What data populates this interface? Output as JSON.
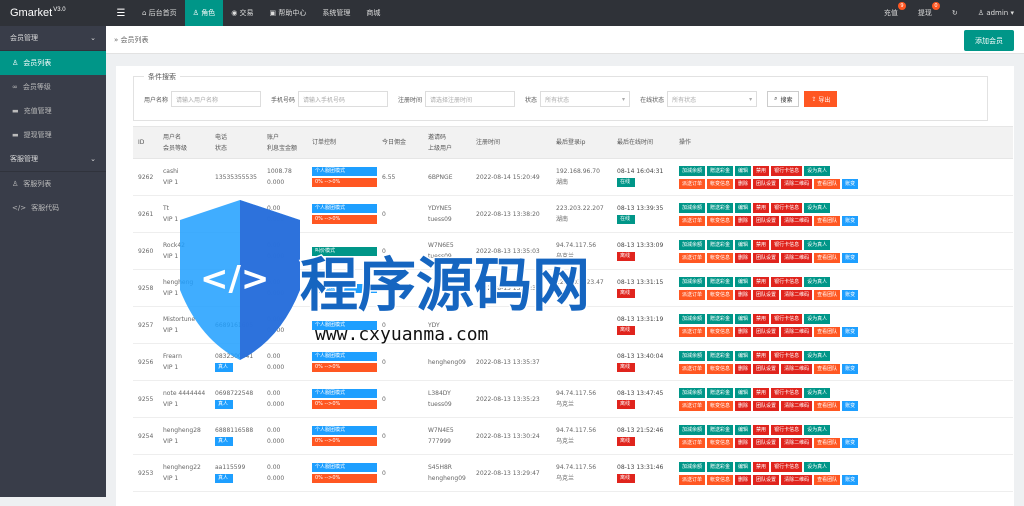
{
  "brand": {
    "name": "Gmarket",
    "version": "V3.0"
  },
  "topnav": [
    {
      "label": "后台首页",
      "icon": "home-icon"
    },
    {
      "label": "角色",
      "icon": "user-icon",
      "active": true
    },
    {
      "label": "交易",
      "icon": "trade-icon"
    },
    {
      "label": "帮助中心",
      "icon": "help-icon"
    },
    {
      "label": "系统管理",
      "icon": "settings-icon"
    },
    {
      "label": "商城",
      "icon": "shop-icon"
    }
  ],
  "topright": {
    "recharge": "充值",
    "recharge_badge": "9",
    "withdraw": "提现",
    "withdraw_badge": "0",
    "refresh_icon": "refresh-icon",
    "user": "admin"
  },
  "sidebar": {
    "group1": "会员管理",
    "items1": [
      "会员列表",
      "会员等级",
      "充值管理",
      "提现管理"
    ],
    "group2": "客服管理",
    "items2": [
      "客服列表",
      "客服代码"
    ]
  },
  "breadcrumb": "会员列表",
  "add_button": "添加会员",
  "search": {
    "legend": "条件搜索",
    "member_label": "用户名称",
    "member_placeholder": "请输入用户名称",
    "phone_label": "手机号码",
    "phone_placeholder": "请输入手机号码",
    "regtime_label": "注册时间",
    "regtime_placeholder": "请选择注册时间",
    "status_label": "状态",
    "status_value": "所有状态",
    "online_label": "在线状态",
    "online_value": "所有状态",
    "search_button": "搜索",
    "export_button": "导出"
  },
  "table": {
    "headers": [
      [
        "ID"
      ],
      [
        "用户名",
        "会员等级"
      ],
      [
        "电话",
        "状态"
      ],
      [
        "账户",
        "利息宝金额"
      ],
      [
        "订单控制"
      ],
      [
        "今日佣金"
      ],
      [
        "邀请码",
        "上级用户"
      ],
      [
        "注册时间"
      ],
      [
        "最后登录ip"
      ],
      [
        "最后在线时间"
      ],
      [
        "操作"
      ]
    ],
    "rows": [
      {
        "id": "9262",
        "user": "cashi",
        "level": "VIP 1",
        "phone": "13535355535",
        "status": "",
        "balance": "1008.78",
        "lixibao": "0.000",
        "order": "个人服团模式",
        "order2": "0% -->0%",
        "commission": "6.55",
        "invite": "6BPNGE",
        "parent": "",
        "reg": "2022-08-14 15:20:49",
        "ip": "192.168.96.70",
        "ip2": "湖南",
        "last": "08-14 16:04:31",
        "online": "在线"
      },
      {
        "id": "9261",
        "user": "Tt",
        "level": "VIP 1",
        "phone": "",
        "status": "",
        "balance": "0.00",
        "lixibao": "0.000",
        "order": "个人服团模式",
        "order2": "0% -->0%",
        "commission": "0",
        "invite": "YDYNE5",
        "parent": "tuess09",
        "reg": "2022-08-13 13:38:20",
        "ip": "223.203.22.207",
        "ip2": "湖南",
        "last": "08-13 13:39:35",
        "online": "在线"
      },
      {
        "id": "9260",
        "user": "Rock42",
        "level": "VIP 1",
        "phone": "",
        "status": "",
        "balance": "0.00",
        "lixibao": "0.000",
        "order": "叫价模式",
        "order2": "",
        "commission": "0",
        "invite": "W7N6E5",
        "parent": "tuess09",
        "reg": "2022-08-13 13:35:03",
        "ip": "94.74.117.56",
        "ip2": "乌克兰",
        "last": "08-13 13:33:09",
        "online": "离线"
      },
      {
        "id": "9258",
        "user": "hengheng",
        "level": "VIP 1",
        "phone": "",
        "status": "",
        "balance": "0.00",
        "lixibao": "0.000",
        "order": "个人服团模式",
        "order2": "",
        "commission": "0",
        "invite": "",
        "parent": "",
        "reg": "2022-08-13 13:35:30",
        "ip": "223.203.223.47",
        "ip2": "湖南",
        "last": "08-13 13:31:15",
        "online": "离线"
      },
      {
        "id": "9257",
        "user": "Mistortune",
        "level": "VIP 1",
        "phone": "6689161605",
        "status": "",
        "balance": "0.000",
        "lixibao": "0.000",
        "order": "个人服团模式",
        "order2": "",
        "commission": "0",
        "invite": "YDY",
        "parent": "",
        "reg": "",
        "ip": "",
        "ip2": "",
        "last": "08-13 13:31:19",
        "online": "离线"
      },
      {
        "id": "9256",
        "user": "Frearn",
        "level": "VIP 1",
        "phone": "0832300041",
        "status": "真人",
        "balance": "0.00",
        "lixibao": "0.000",
        "order": "个人服团模式",
        "order2": "0% -->0%",
        "commission": "0",
        "invite": "",
        "parent": "hengheng09",
        "reg": "2022-08-13 13:35:37",
        "ip": "",
        "ip2": "",
        "last": "08-13 13:40:04",
        "online": "离线"
      },
      {
        "id": "9255",
        "user": "note 4444444",
        "level": "VIP 1",
        "phone": "0698722548",
        "status": "真人",
        "balance": "0.00",
        "lixibao": "0.000",
        "order": "个人服团模式",
        "order2": "0% -->0%",
        "commission": "0",
        "invite": "L384DY",
        "parent": "tuess09",
        "reg": "2022-08-13 13:35:23",
        "ip": "94.74.117.56",
        "ip2": "乌克兰",
        "last": "08-13 13:47:45",
        "online": "离线"
      },
      {
        "id": "9254",
        "user": "hengheng28",
        "level": "VIP 1",
        "phone": "6888116588",
        "status": "真人",
        "balance": "0.00",
        "lixibao": "0.000",
        "order": "个人服团模式",
        "order2": "0% -->0%",
        "commission": "0",
        "invite": "W7N4E5",
        "parent": "777999",
        "reg": "2022-08-13 13:30:24",
        "ip": "94.74.117.56",
        "ip2": "乌克兰",
        "last": "08-13 21:52:46",
        "online": "离线"
      },
      {
        "id": "9253",
        "user": "hengheng22",
        "level": "VIP 1",
        "phone": "aa115599",
        "status": "真人",
        "balance": "0.00",
        "lixibao": "0.000",
        "order": "个人服团模式",
        "order2": "0% -->0%",
        "commission": "0",
        "invite": "S45H8R",
        "parent": "hengheng09",
        "reg": "2022-08-13 13:29:47",
        "ip": "94.74.117.56",
        "ip2": "乌克兰",
        "last": "08-13 13:31:46",
        "online": "离线"
      }
    ],
    "ops_row1": [
      "加減余額",
      "赠送彩金",
      "编辑",
      "禁用",
      "银行卡信息",
      "设为真人"
    ],
    "ops_row2": [
      "派送订单",
      "帐变信息",
      "删除",
      "团队设置",
      "清除二维码",
      "查看团队",
      "账变"
    ]
  },
  "watermark": {
    "title": "程序源码网",
    "url": "www.cxyuanma.com"
  }
}
